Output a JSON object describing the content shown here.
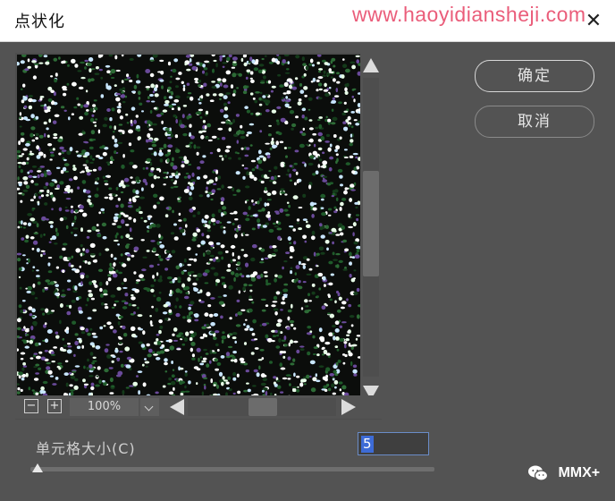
{
  "window": {
    "title": "点状化",
    "watermark": "www.haoyidiansheji.com",
    "close_glyph": "✕"
  },
  "preview": {
    "zoom_out_glyph": "−",
    "zoom_in_glyph": "+",
    "zoom_level": "100%"
  },
  "buttons": {
    "ok_label": "确定",
    "cancel_label": "取消"
  },
  "cell_size": {
    "label": "单元格大小(C)",
    "value": "5"
  },
  "badge": {
    "text": "MMX+",
    "icon": "wechat-icon"
  },
  "colors": {
    "dialog_bg": "#535353",
    "preview_bg": "#0b0d0b",
    "dot_green": "#1f5a2a",
    "dot_white": "#ffffff",
    "selection": "#3d6bd6",
    "watermark": "#ea5d7a"
  }
}
